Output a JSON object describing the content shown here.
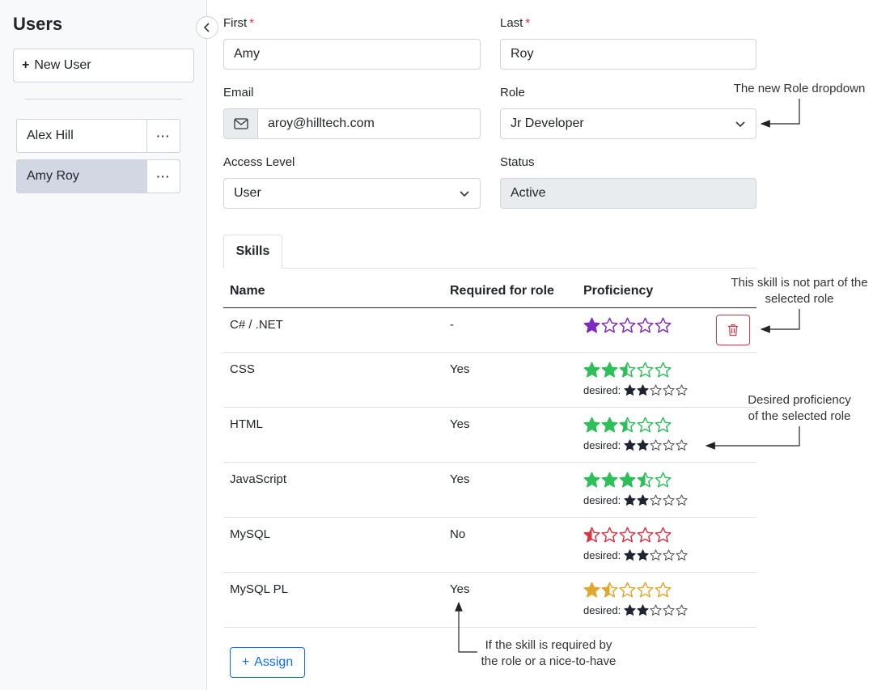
{
  "sidebar": {
    "title": "Users",
    "new_user_label": "New User",
    "users": [
      {
        "name": "Alex Hill",
        "menu": "···"
      },
      {
        "name": "Amy Roy",
        "menu": "···"
      }
    ]
  },
  "form": {
    "first_label": "First",
    "first_value": "Amy",
    "last_label": "Last",
    "last_value": "Roy",
    "email_label": "Email",
    "email_value": "aroy@hilltech.com",
    "role_label": "Role",
    "role_value": "Jr Developer",
    "access_label": "Access Level",
    "access_value": "User",
    "status_label": "Status",
    "status_value": "Active",
    "required_mark": "*"
  },
  "tabs": [
    {
      "label": "Skills"
    }
  ],
  "skills_table": {
    "headers": {
      "name": "Name",
      "required": "Required for role",
      "proficiency": "Proficiency"
    },
    "desired_label": "desired:",
    "rows": [
      {
        "name": "C# / .NET",
        "required": "-",
        "rating": 1,
        "color": "#7b2cbf",
        "desired": null
      },
      {
        "name": "CSS",
        "required": "Yes",
        "rating": 2.5,
        "color": "#2fbf5a",
        "desired": 2
      },
      {
        "name": "HTML",
        "required": "Yes",
        "rating": 2.5,
        "color": "#2fbf5a",
        "desired": 2
      },
      {
        "name": "JavaScript",
        "required": "Yes",
        "rating": 3.5,
        "color": "#2fbf5a",
        "desired": 2
      },
      {
        "name": "MySQL",
        "required": "No",
        "rating": 0.5,
        "color": "#dc3545",
        "desired": 2
      },
      {
        "name": "MySQL PL",
        "required": "Yes",
        "rating": 1.5,
        "color": "#e0a82e",
        "desired": 2
      }
    ],
    "assign_label": "Assign"
  },
  "annotations": {
    "role_note": "The new Role dropdown",
    "skill_note_1": "This skill is not part of the",
    "skill_note_2": "selected role",
    "desired_note_1": "Desired proficiency",
    "desired_note_2": "of the selected role",
    "required_note_1": "If the skill is required by",
    "required_note_2": "the role or a nice-to-have"
  },
  "icons": {
    "collapse": "chevron-left-icon",
    "email": "envelope-icon",
    "dropdown": "chevron-down-icon",
    "delete": "trash-icon",
    "menu": "ellipsis-icon"
  }
}
